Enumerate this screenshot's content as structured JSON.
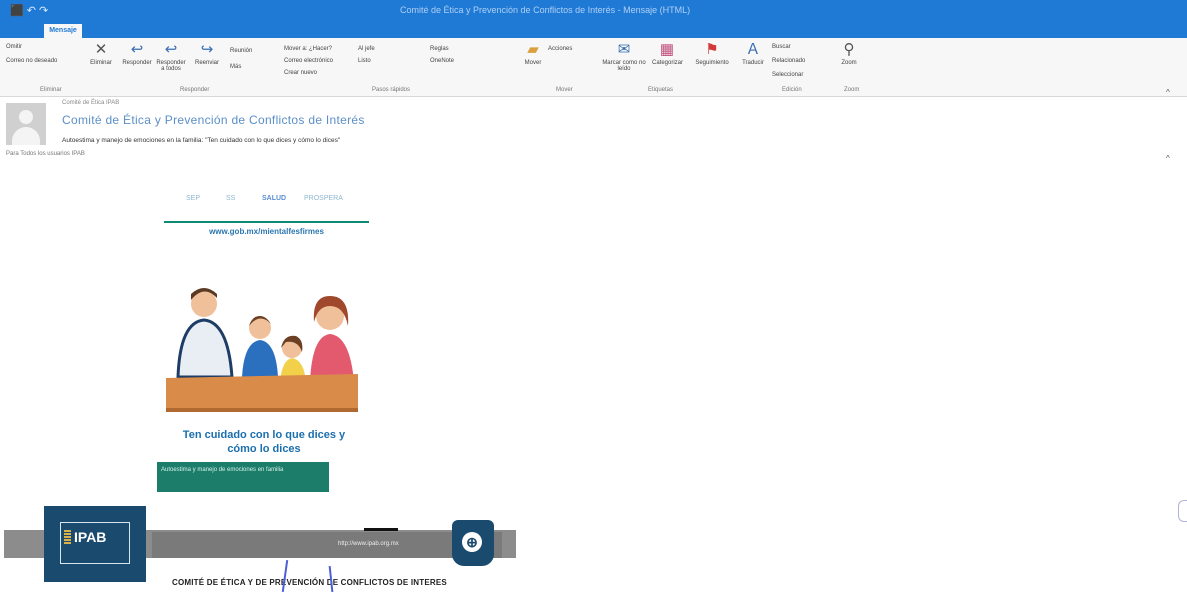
{
  "window": {
    "title": "Comité de Ética y Prevención de Conflictos de Interés - Mensaje (HTML)"
  },
  "tabs": {
    "active": "Mensaje"
  },
  "ribbon": {
    "delete_group": {
      "ignore": "Omitir",
      "junk": "Correo no deseado",
      "delete": "Eliminar",
      "label": "Eliminar"
    },
    "respond_group": {
      "reply": "Responder",
      "reply_all": "Responder a todos",
      "forward": "Reenviar",
      "meeting": "Reunión",
      "more": "Más",
      "label": "Responder"
    },
    "quick_steps": {
      "item1": "Mover a: ¿Hacer?",
      "item2": "Correo electrónico",
      "item3": "Crear nuevo",
      "item4": "Al jefe",
      "item5": "Listo",
      "label": "Pasos rápidos"
    },
    "move_group": {
      "move": "Mover",
      "rules": "Reglas",
      "onenote": "OneNote",
      "actions": "Acciones",
      "label": "Mover"
    },
    "tags_group": {
      "unread": "Marcar como no leído",
      "categorize": "Categorizar",
      "followup": "Seguimiento",
      "label": "Etiquetas"
    },
    "editing_group": {
      "translate": "Traducir",
      "find": "Buscar",
      "related": "Relacionado",
      "select": "Seleccionar",
      "label": "Edición"
    },
    "zoom_group": {
      "zoom": "Zoom",
      "label": "Zoom"
    }
  },
  "message": {
    "sender": "Comité de Ética IPAB",
    "subject": "Comité de Ética y Prevención de Conflictos de Interés",
    "preview": "Autoestima y manejo de emociones en la familia: \"Ten cuidado con lo que dices y cómo lo dices\"",
    "to": "Para  Todos los usuarios IPAB"
  },
  "email_body": {
    "partners": [
      "SEP",
      "SS",
      "SALUD",
      "PROSPERA"
    ],
    "url": "www.gob.mx/mientalfesfirmes",
    "tagline_line1": "Ten cuidado con lo que dices y",
    "tagline_line2": "cómo lo dices",
    "cta_text": "Autoestima y manejo de emociones en familia",
    "logo_text": "IPAB",
    "footer_url": "http://www.ipab.org.mx",
    "footer_caption": "COMITÉ DE ÉTICA Y DE PREVENCIÓN DE CONFLICTOS DE INTERES"
  },
  "colors": {
    "titlebar": "#1f7ad6",
    "accent_green": "#1c7d6b",
    "brand_navy": "#1a4a6e",
    "link_blue": "#2a77b0"
  }
}
